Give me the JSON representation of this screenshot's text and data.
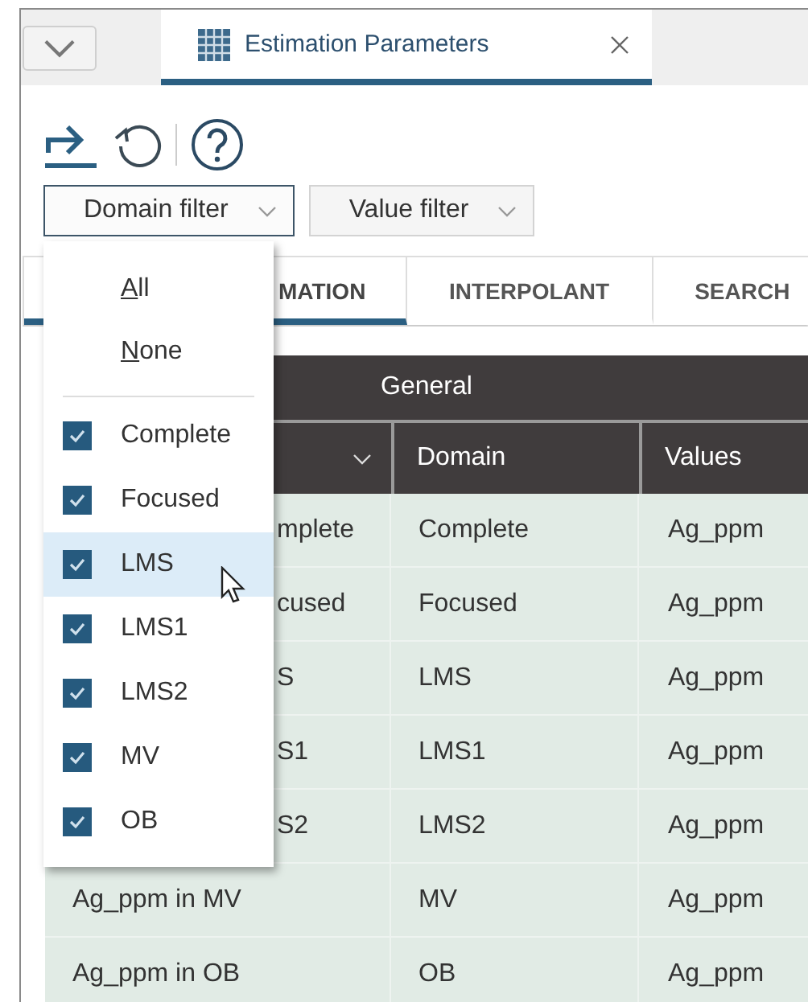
{
  "document_tab": {
    "title": "Estimation Parameters",
    "selected": true
  },
  "filters": [
    {
      "label": "Domain filter",
      "open": true
    },
    {
      "label": "Value filter",
      "open": false
    }
  ],
  "sub_tabs": [
    {
      "label": "MATION",
      "selected": true,
      "covered": true
    },
    {
      "label": "INTERPOLANT",
      "selected": false,
      "covered": false
    },
    {
      "label": "SEARCH",
      "selected": false,
      "covered": false
    }
  ],
  "table": {
    "group_header": "General",
    "columns": [
      "",
      "Domain",
      "Values"
    ],
    "rows": [
      {
        "cells": [
          "mplete",
          "Complete",
          "Ag_ppm"
        ],
        "covered": true
      },
      {
        "cells": [
          "cused",
          "Focused",
          "Ag_ppm"
        ],
        "covered": true
      },
      {
        "cells": [
          "S",
          "LMS",
          "Ag_ppm"
        ],
        "covered": true
      },
      {
        "cells": [
          "S1",
          "LMS1",
          "Ag_ppm"
        ],
        "covered": true
      },
      {
        "cells": [
          "S2",
          "LMS2",
          "Ag_ppm"
        ],
        "covered": true
      },
      {
        "cells": [
          "Ag_ppm in MV",
          "MV",
          "Ag_ppm"
        ],
        "covered": false
      },
      {
        "cells": [
          "Ag_ppm in OB",
          "OB",
          "Ag_ppm"
        ],
        "covered": false
      }
    ]
  },
  "domain_menu": {
    "actions": [
      {
        "mnemonic": "A",
        "rest": "ll"
      },
      {
        "mnemonic": "N",
        "rest": "one"
      }
    ],
    "items": [
      {
        "label": "Complete",
        "checked": true,
        "selected": false
      },
      {
        "label": "Focused",
        "checked": true,
        "selected": false
      },
      {
        "label": "LMS",
        "checked": true,
        "selected": true
      },
      {
        "label": "LMS1",
        "checked": true,
        "selected": false
      },
      {
        "label": "LMS2",
        "checked": true,
        "selected": false
      },
      {
        "label": "MV",
        "checked": true,
        "selected": false
      },
      {
        "label": "OB",
        "checked": true,
        "selected": false
      }
    ]
  }
}
